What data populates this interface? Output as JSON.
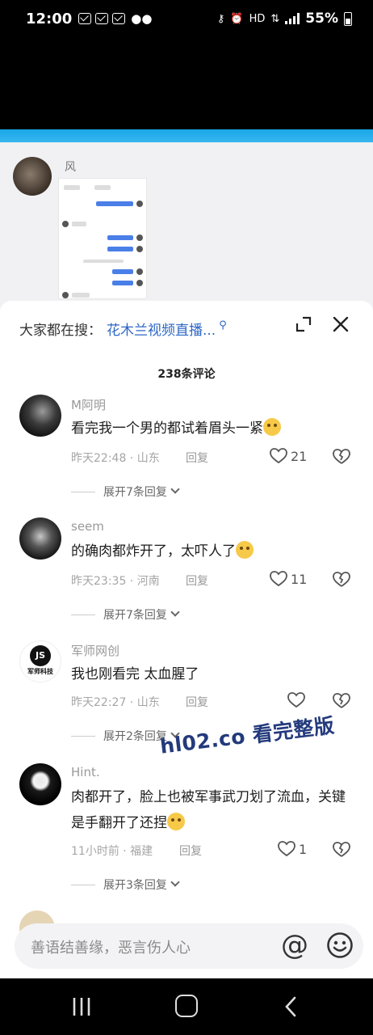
{
  "status_bar": {
    "time": "12:00",
    "battery": "55%",
    "network": "HD"
  },
  "post": {
    "author": "风"
  },
  "sheet": {
    "search_label": "大家都在搜：",
    "search_link": "花木兰视频直播...",
    "comment_count": "238条评论",
    "comments": [
      {
        "name": "M阿明",
        "text": "看完我一个男的都试着眉头一紧",
        "time": "昨天22:48 · 山东",
        "reply": "回复",
        "likes": "21",
        "expand": "展开7条回复"
      },
      {
        "name": "seem",
        "text": "的确肉都炸开了，太吓人了",
        "time": "昨天23:35 · 河南",
        "reply": "回复",
        "likes": "11",
        "expand": "展开7条回复"
      },
      {
        "name": "军师网创",
        "text": "我也刚看完 太血腥了",
        "time": "昨天22:27 · 山东",
        "reply": "回复",
        "likes": "",
        "expand": "展开2条回复",
        "avatar_text": "JS",
        "avatar_sub": "军师科技"
      },
      {
        "name": "Hint.",
        "text": "肉都开了，脸上也被军事武刀划了流血，关键是手翻开了还捏",
        "time": "11小时前 · 福建",
        "reply": "回复",
        "likes": "1",
        "expand": "展开3条回复"
      }
    ],
    "watermark": "hl02.co 看完整版",
    "input_placeholder": "善语结善缘，恶言伤人心"
  }
}
